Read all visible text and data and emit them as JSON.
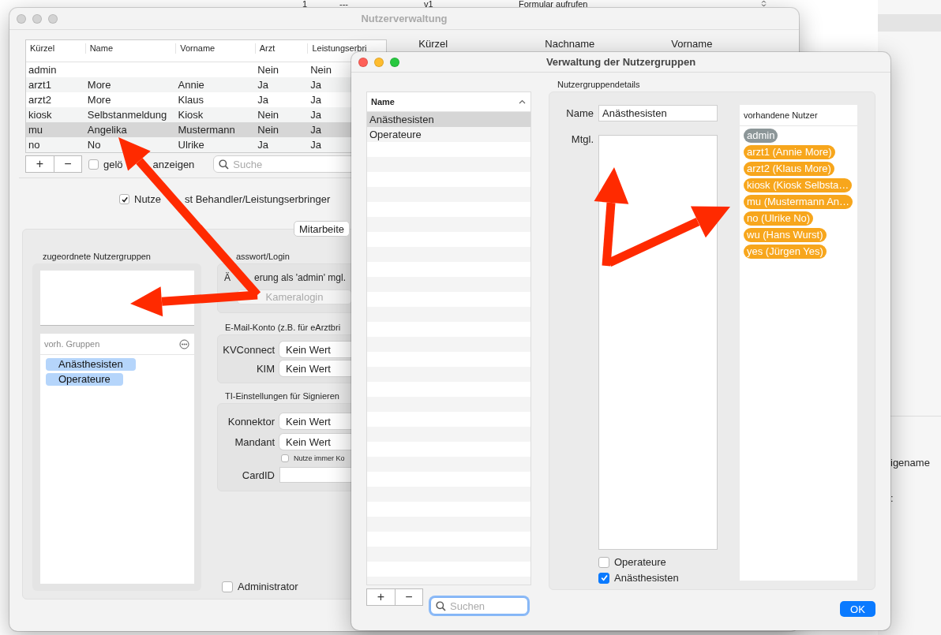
{
  "background_app": {
    "row": {
      "column_1": "1",
      "column_2": "---",
      "column_3": "v1"
    },
    "form_select": "Formular aufrufen",
    "side_label": "igename",
    "side_mark": ":"
  },
  "user_window": {
    "title": "Nutzerverwaltung",
    "users_table": {
      "columns": [
        "Kürzel",
        "Name",
        "Vorname",
        "Arzt",
        "Leistungserbri"
      ],
      "rows": [
        {
          "cells": [
            "admin",
            "",
            "",
            "Nein",
            "Nein"
          ],
          "selected": false
        },
        {
          "cells": [
            "arzt1",
            "More",
            "Annie",
            "Ja",
            "Ja"
          ],
          "selected": false
        },
        {
          "cells": [
            "arzt2",
            "More",
            "Klaus",
            "Ja",
            "Ja"
          ],
          "selected": false
        },
        {
          "cells": [
            "kiosk",
            "Selbstanmeldung",
            "Kiosk",
            "Nein",
            "Ja"
          ],
          "selected": false
        },
        {
          "cells": [
            "mu",
            "Angelika",
            "Mustermann",
            "Nein",
            "Ja"
          ],
          "selected": true
        },
        {
          "cells": [
            "no",
            "No",
            "Ulrike",
            "Ja",
            "Ja"
          ],
          "selected": false
        }
      ]
    },
    "add_button": "+",
    "remove_button": "−",
    "show_deleted": {
      "label_parts": [
        "gelö",
        "anzeigen"
      ],
      "checked": false
    },
    "search": {
      "placeholder": "Suche"
    },
    "detail_table": {
      "columns": [
        "Kürzel",
        "Nachname",
        "Vorname"
      ]
    },
    "is_provider": {
      "label_parts": [
        "Nutze",
        "st Behandler/Leistungserbringer"
      ],
      "checked": true
    },
    "tab_button": "Mitarbeite",
    "assigned_groups": {
      "title": "zugeordnete Nutzergruppen",
      "available_header": "vorh. Gruppen",
      "available": [
        "Anästhesisten",
        "Operateure"
      ]
    },
    "password": {
      "title": "asswort/Login",
      "change_label_parts": [
        "Ä",
        "erung als 'admin' mgl."
      ],
      "camera_login": {
        "label": "Kameralogin",
        "disabled": true
      }
    },
    "email": {
      "title": "E-Mail-Konto (z.B. für eArztbri",
      "fields": [
        {
          "label": "KVConnect",
          "value": "Kein Wert"
        },
        {
          "label": "KIM",
          "value": "Kein Wert"
        }
      ]
    },
    "ti": {
      "title": "TI-Einstellungen für Signieren",
      "fields": [
        {
          "label": "Konnektor",
          "value": "Kein Wert"
        },
        {
          "label": "Mandant",
          "value": "Kein Wert"
        }
      ],
      "always_use": {
        "label": "Nutze immer Ko",
        "checked": false
      },
      "card_id_label": "CardID"
    },
    "administrator": {
      "label": "Administrator",
      "checked": false
    }
  },
  "groups_dialog": {
    "title": "Verwaltung der Nutzergruppen",
    "list": {
      "header": "Name",
      "rows": [
        {
          "name": "Anästhesisten",
          "selected": true
        },
        {
          "name": "Operateure",
          "selected": false
        }
      ]
    },
    "add_button": "+",
    "remove_button": "−",
    "search": {
      "placeholder": "Suchen"
    },
    "details": {
      "title": "Nutzergruppendetails",
      "name_label": "Name",
      "name_value": "Anästhesisten",
      "members_label": "Mtgl.",
      "groups": [
        {
          "label": "Operateure",
          "checked": false
        },
        {
          "label": "Anästhesisten",
          "checked": true
        }
      ],
      "users": {
        "header": "vorhandene Nutzer",
        "items": [
          {
            "label": "admin",
            "color": "#8c9698"
          },
          {
            "label": "arzt1 (Annie More)",
            "color": "#f7a61c"
          },
          {
            "label": "arzt2 (Klaus More)",
            "color": "#f7a61c"
          },
          {
            "label": "kiosk (Kiosk Selbsta…",
            "color": "#f7a61c"
          },
          {
            "label": "mu (Mustermann An…",
            "color": "#f7a61c"
          },
          {
            "label": "no (Ulrike No)",
            "color": "#f7a61c"
          },
          {
            "label": "wu (Hans Wurst)",
            "color": "#f7a61c"
          },
          {
            "label": "yes (Jürgen Yes)",
            "color": "#f7a61c"
          }
        ]
      }
    },
    "ok_button": "OK"
  }
}
